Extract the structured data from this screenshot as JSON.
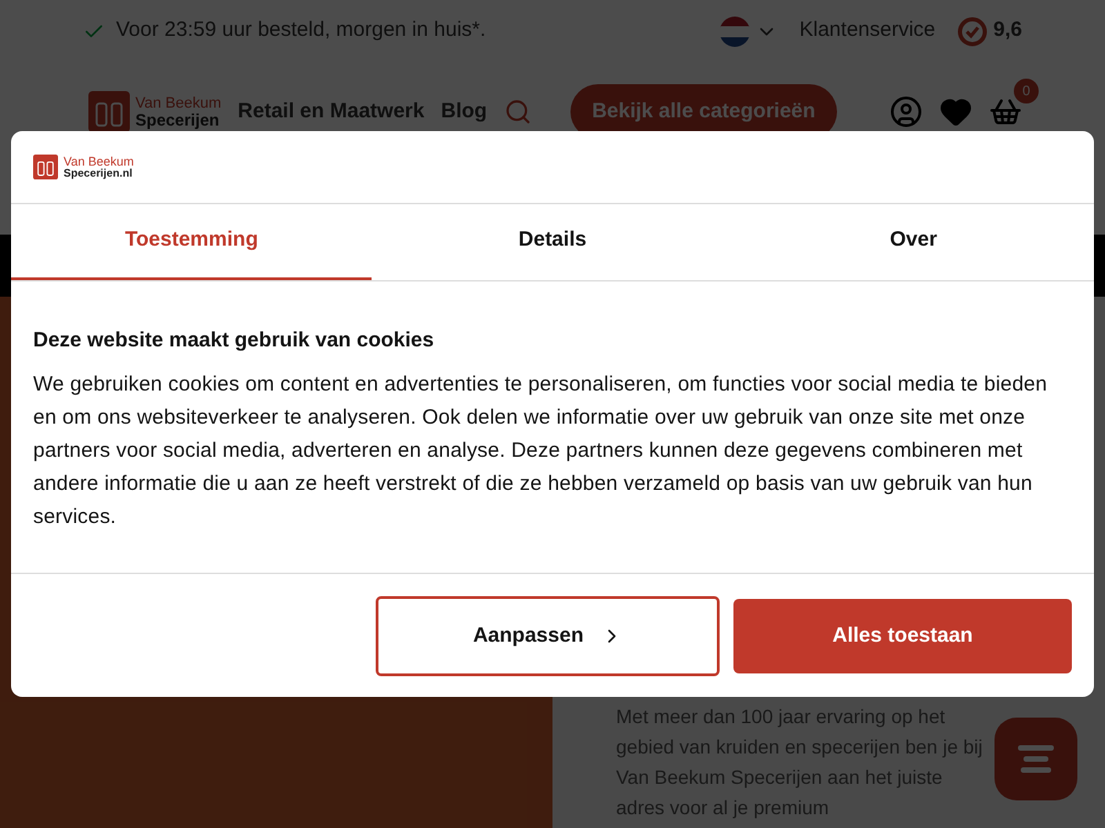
{
  "topbar": {
    "promo": "Voor 23:59 uur besteld, morgen in huis*.",
    "service": "Klantenservice",
    "rating": "9,6"
  },
  "header": {
    "logo": {
      "line1": "Van Beekum",
      "line2": "Specerijen"
    },
    "nav": [
      "Retail en Maatwerk",
      "Blog"
    ],
    "categories_button": "Bekijk alle categorieën",
    "cart_count": "0"
  },
  "intro": "Met meer dan 100 jaar ervaring op het gebied van kruiden en specerijen ben je bij Van Beekum Specerijen aan het juiste adres voor al je premium",
  "dialog": {
    "logo": {
      "line1": "Van Beekum",
      "line2": "Specerijen.nl"
    },
    "tabs": [
      {
        "label": "Toestemming",
        "selected": true
      },
      {
        "label": "Details",
        "selected": false
      },
      {
        "label": "Over",
        "selected": false
      }
    ],
    "title": "Deze website maakt gebruik van cookies",
    "body": "We gebruiken cookies om content en advertenties te personaliseren, om functies voor social media te bieden en om ons websiteverkeer te analyseren. Ook delen we informatie over uw gebruik van onze site met onze partners voor social media, adverteren en analyse. Deze partners kunnen deze gegevens combineren met andere informatie die u aan ze heeft verstrekt of die ze hebben verzameld op basis van uw gebruik van hun services.",
    "buttons": [
      {
        "label": "Aanpassen",
        "kind": "outline"
      },
      {
        "label": "Alles toestaan",
        "kind": "primary"
      }
    ]
  }
}
